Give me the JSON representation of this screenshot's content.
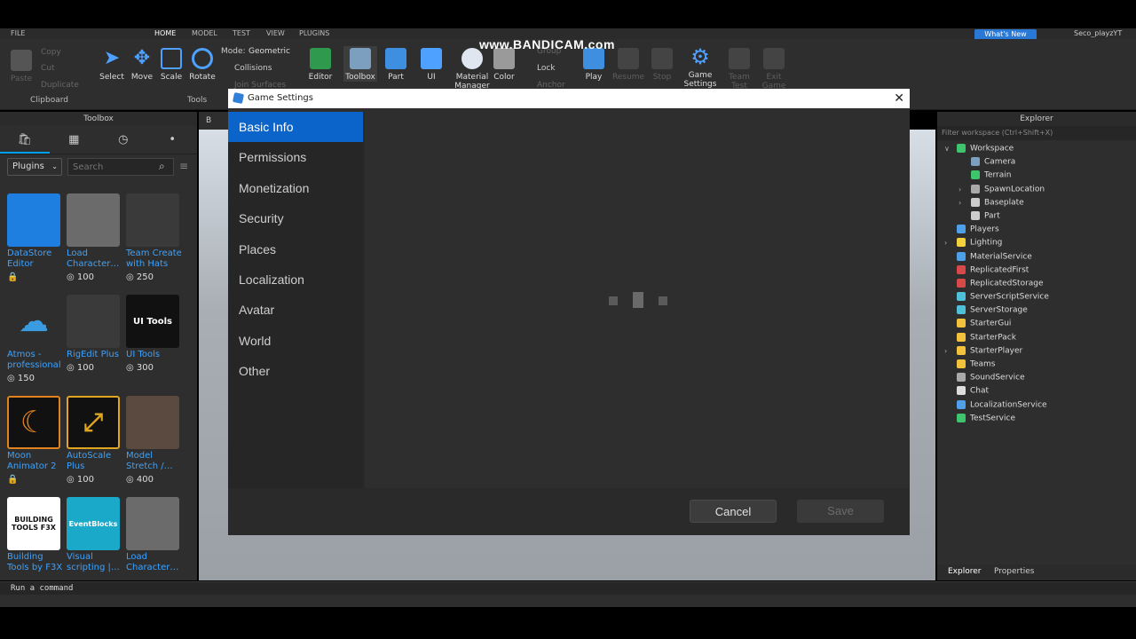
{
  "menubar": {
    "items": [
      "FILE",
      "HOME",
      "MODEL",
      "TEST",
      "VIEW",
      "PLUGINS"
    ]
  },
  "watermark": "www.BANDICAM.com",
  "whats_new": "What's New",
  "username": "Seco_playzYT",
  "ribbon": {
    "clipboard": {
      "paste": "Paste",
      "copy": "Copy",
      "cut": "Cut",
      "duplicate": "Duplicate",
      "label": "Clipboard"
    },
    "tools": {
      "select": "Select",
      "move": "Move",
      "scale": "Scale",
      "rotate": "Rotate",
      "label": "Tools",
      "mode_label": "Mode:",
      "mode_value": "Geometric",
      "collisions": "Collisions",
      "join_surfaces": "Join Surfaces"
    },
    "buttons": [
      "Editor",
      "Toolbox",
      "Part",
      "UI",
      "Material Manager",
      "Color",
      "Group",
      "Lock",
      "Anchor",
      "Play",
      "Resume",
      "Stop",
      "Game Settings",
      "Team Test",
      "Exit Game"
    ]
  },
  "toolbox": {
    "title": "Toolbox",
    "category": "Plugins",
    "search_placeholder": "Search",
    "items": [
      {
        "name": "DataStore\nEditor",
        "price": "",
        "color": "#1e7fe0",
        "thumb": ""
      },
      {
        "name": "Load\nCharacter…",
        "price": "100",
        "color": "#6b6b6b",
        "thumb": ""
      },
      {
        "name": "Team Create\nwith Hats",
        "price": "250",
        "color": "#3a3a3a",
        "thumb": ""
      },
      {
        "name": "Atmos -\nprofessional",
        "price": "150",
        "color": "#1d3f66",
        "thumb": ""
      },
      {
        "name": "RigEdit Plus",
        "price": "100",
        "color": "#3a3a3a",
        "thumb": ""
      },
      {
        "name": "UI Tools",
        "price": "300",
        "color": "#111111",
        "thumb": "UI Tools"
      },
      {
        "name": "Moon\nAnimator 2",
        "price": "",
        "color": "#e0821e",
        "thumb": ""
      },
      {
        "name": "AutoScale\nPlus",
        "price": "100",
        "color": "#e0a51e",
        "thumb": ""
      },
      {
        "name": "Model\nStretch /…",
        "price": "400",
        "color": "#5a4a40",
        "thumb": ""
      },
      {
        "name": "Building\nTools by F3X",
        "price": "",
        "color": "#ffffff",
        "thumb": "BUILDING TOOLS F3X"
      },
      {
        "name": "Visual\nscripting |…",
        "price": "",
        "color": "#1aa9c9",
        "thumb": "EventBlocks"
      },
      {
        "name": "Load\nCharacter…",
        "price": "",
        "color": "#6b6b6b",
        "thumb": ""
      }
    ]
  },
  "viewport": {
    "tab": "B"
  },
  "dialog": {
    "title": "Game Settings",
    "nav": [
      "Basic Info",
      "Permissions",
      "Monetization",
      "Security",
      "Places",
      "Localization",
      "Avatar",
      "World",
      "Other"
    ],
    "cancel": "Cancel",
    "save": "Save"
  },
  "explorer": {
    "title": "Explorer",
    "filter_placeholder": "Filter workspace (Ctrl+Shift+X)",
    "nodes": [
      {
        "label": "Workspace",
        "depth": 0,
        "arrow": "v",
        "color": "#3ec46d"
      },
      {
        "label": "Camera",
        "depth": 1,
        "arrow": "",
        "color": "#7c9fbf"
      },
      {
        "label": "Terrain",
        "depth": 1,
        "arrow": "",
        "color": "#3ec46d"
      },
      {
        "label": "SpawnLocation",
        "depth": 1,
        "arrow": ">",
        "color": "#aaaaaa"
      },
      {
        "label": "Baseplate",
        "depth": 1,
        "arrow": ">",
        "color": "#cccccc"
      },
      {
        "label": "Part",
        "depth": 1,
        "arrow": "",
        "color": "#cccccc"
      },
      {
        "label": "Players",
        "depth": 0,
        "arrow": "",
        "color": "#4ea1e8"
      },
      {
        "label": "Lighting",
        "depth": 0,
        "arrow": ">",
        "color": "#f2d13c"
      },
      {
        "label": "MaterialService",
        "depth": 0,
        "arrow": "",
        "color": "#4ea1e8"
      },
      {
        "label": "ReplicatedFirst",
        "depth": 0,
        "arrow": "",
        "color": "#d84a4a"
      },
      {
        "label": "ReplicatedStorage",
        "depth": 0,
        "arrow": "",
        "color": "#d84a4a"
      },
      {
        "label": "ServerScriptService",
        "depth": 0,
        "arrow": "",
        "color": "#4ec1d9"
      },
      {
        "label": "ServerStorage",
        "depth": 0,
        "arrow": "",
        "color": "#4ec1d9"
      },
      {
        "label": "StarterGui",
        "depth": 0,
        "arrow": "",
        "color": "#f2c23c"
      },
      {
        "label": "StarterPack",
        "depth": 0,
        "arrow": "",
        "color": "#f2c23c"
      },
      {
        "label": "StarterPlayer",
        "depth": 0,
        "arrow": ">",
        "color": "#f2c23c"
      },
      {
        "label": "Teams",
        "depth": 0,
        "arrow": "",
        "color": "#f2c23c"
      },
      {
        "label": "SoundService",
        "depth": 0,
        "arrow": "",
        "color": "#aaaaaa"
      },
      {
        "label": "Chat",
        "depth": 0,
        "arrow": "",
        "color": "#dddddd"
      },
      {
        "label": "LocalizationService",
        "depth": 0,
        "arrow": "",
        "color": "#4ea1e8"
      },
      {
        "label": "TestService",
        "depth": 0,
        "arrow": "",
        "color": "#3ec46d"
      }
    ],
    "tabs": [
      "Explorer",
      "Properties"
    ]
  },
  "command_bar": {
    "placeholder": "Run a command"
  }
}
